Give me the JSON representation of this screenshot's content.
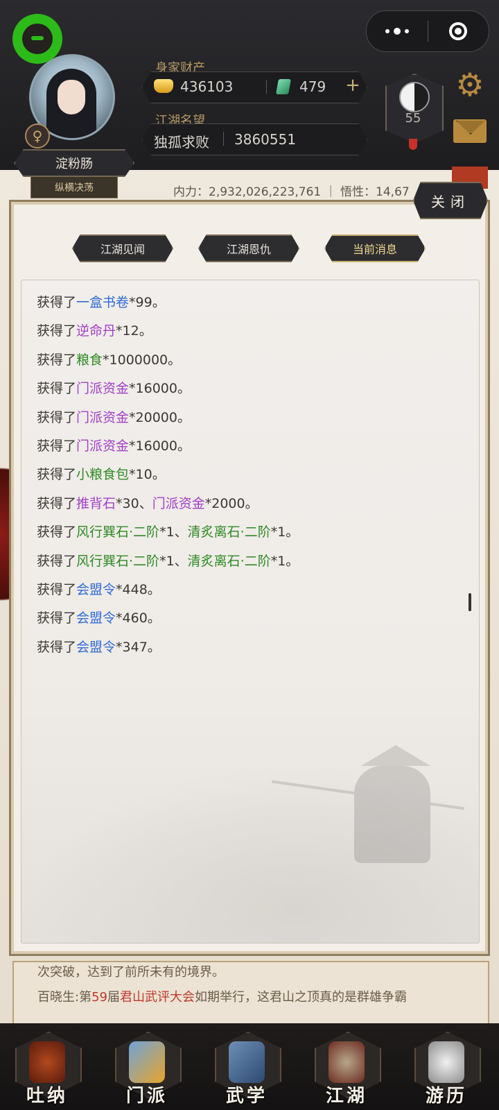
{
  "hud": {
    "wealth_label": "身家财产",
    "gold_amount": "436103",
    "jade_amount": "479",
    "add_icon": "plus-icon",
    "reputation_label": "江湖名望",
    "reputation_title": "独孤求败",
    "reputation_value": "3860551",
    "level": "55",
    "player_name": "淀粉肠",
    "player_title": "纵横决荡",
    "gender_symbol": "♀",
    "settings_icon": "gear-icon",
    "mail_icon": "mail-icon",
    "stats_line": "内力：2,932,026,223,761 ｜ 悟性：14,67"
  },
  "capsule": {
    "more_icon": "more-dots-icon",
    "close_icon": "target-close-icon"
  },
  "modal": {
    "close_label": "关闭",
    "tabs": [
      {
        "label": "江湖见闻",
        "active": false
      },
      {
        "label": "江湖恩仇",
        "active": false
      },
      {
        "label": "当前消息",
        "active": true
      }
    ],
    "messages": [
      {
        "prefix": "获得了",
        "item1": "一盒书卷",
        "c1": "blue",
        "suffix1": "*99。"
      },
      {
        "prefix": "获得了",
        "item1": "逆命丹",
        "c1": "purple",
        "suffix1": "*12。"
      },
      {
        "prefix": "获得了",
        "item1": "粮食",
        "c1": "green",
        "suffix1": "*1000000。"
      },
      {
        "prefix": "获得了",
        "item1": "门派资金",
        "c1": "purple",
        "suffix1": "*16000。"
      },
      {
        "prefix": "获得了",
        "item1": "门派资金",
        "c1": "purple",
        "suffix1": "*20000。"
      },
      {
        "prefix": "获得了",
        "item1": "门派资金",
        "c1": "purple",
        "suffix1": "*16000。"
      },
      {
        "prefix": "获得了",
        "item1": "小粮食包",
        "c1": "green",
        "suffix1": "*10。"
      },
      {
        "prefix": "获得了",
        "item1": "推背石",
        "c1": "purple",
        "suffix1": "*30、",
        "item2": "门派资金",
        "c2": "purple",
        "suffix2": "*2000。"
      },
      {
        "prefix": "获得了",
        "item1": "风行巽石·二阶",
        "c1": "green",
        "suffix1": "*1、",
        "item2": "清炙离石·二阶",
        "c2": "green",
        "suffix2": "*1。"
      },
      {
        "prefix": "获得了",
        "item1": "风行巽石·二阶",
        "c1": "green",
        "suffix1": "*1、",
        "item2": "清炙离石·二阶",
        "c2": "green",
        "suffix2": "*1。"
      },
      {
        "prefix": "获得了",
        "item1": "会盟令",
        "c1": "blue",
        "suffix1": "*448。"
      },
      {
        "prefix": "获得了",
        "item1": "会盟令",
        "c1": "blue",
        "suffix1": "*460。"
      },
      {
        "prefix": "获得了",
        "item1": "会盟令",
        "c1": "blue",
        "suffix1": "*347。"
      }
    ]
  },
  "news": {
    "line1": "次突破，达到了前所未有的境界。",
    "line2_prefix": "百晓生:第",
    "line2_num": "59",
    "line2_mid": "届",
    "line2_event": "君山武评大会",
    "line2_suffix": "如期举行，这君山之顶真的是群雄争霸"
  },
  "bottom_nav": [
    {
      "label": "吐纳",
      "icon": "meditation-icon"
    },
    {
      "label": "门派",
      "icon": "sect-icon"
    },
    {
      "label": "武学",
      "icon": "martial-arts-icon"
    },
    {
      "label": "江湖",
      "icon": "jianghu-icon"
    },
    {
      "label": "游历",
      "icon": "travel-icon"
    }
  ],
  "colors": {
    "blue": "#2f6bd6",
    "purple": "#a23fc6",
    "green": "#2e8a22",
    "red": "#c0392b",
    "accent_gold": "#b79a64"
  }
}
